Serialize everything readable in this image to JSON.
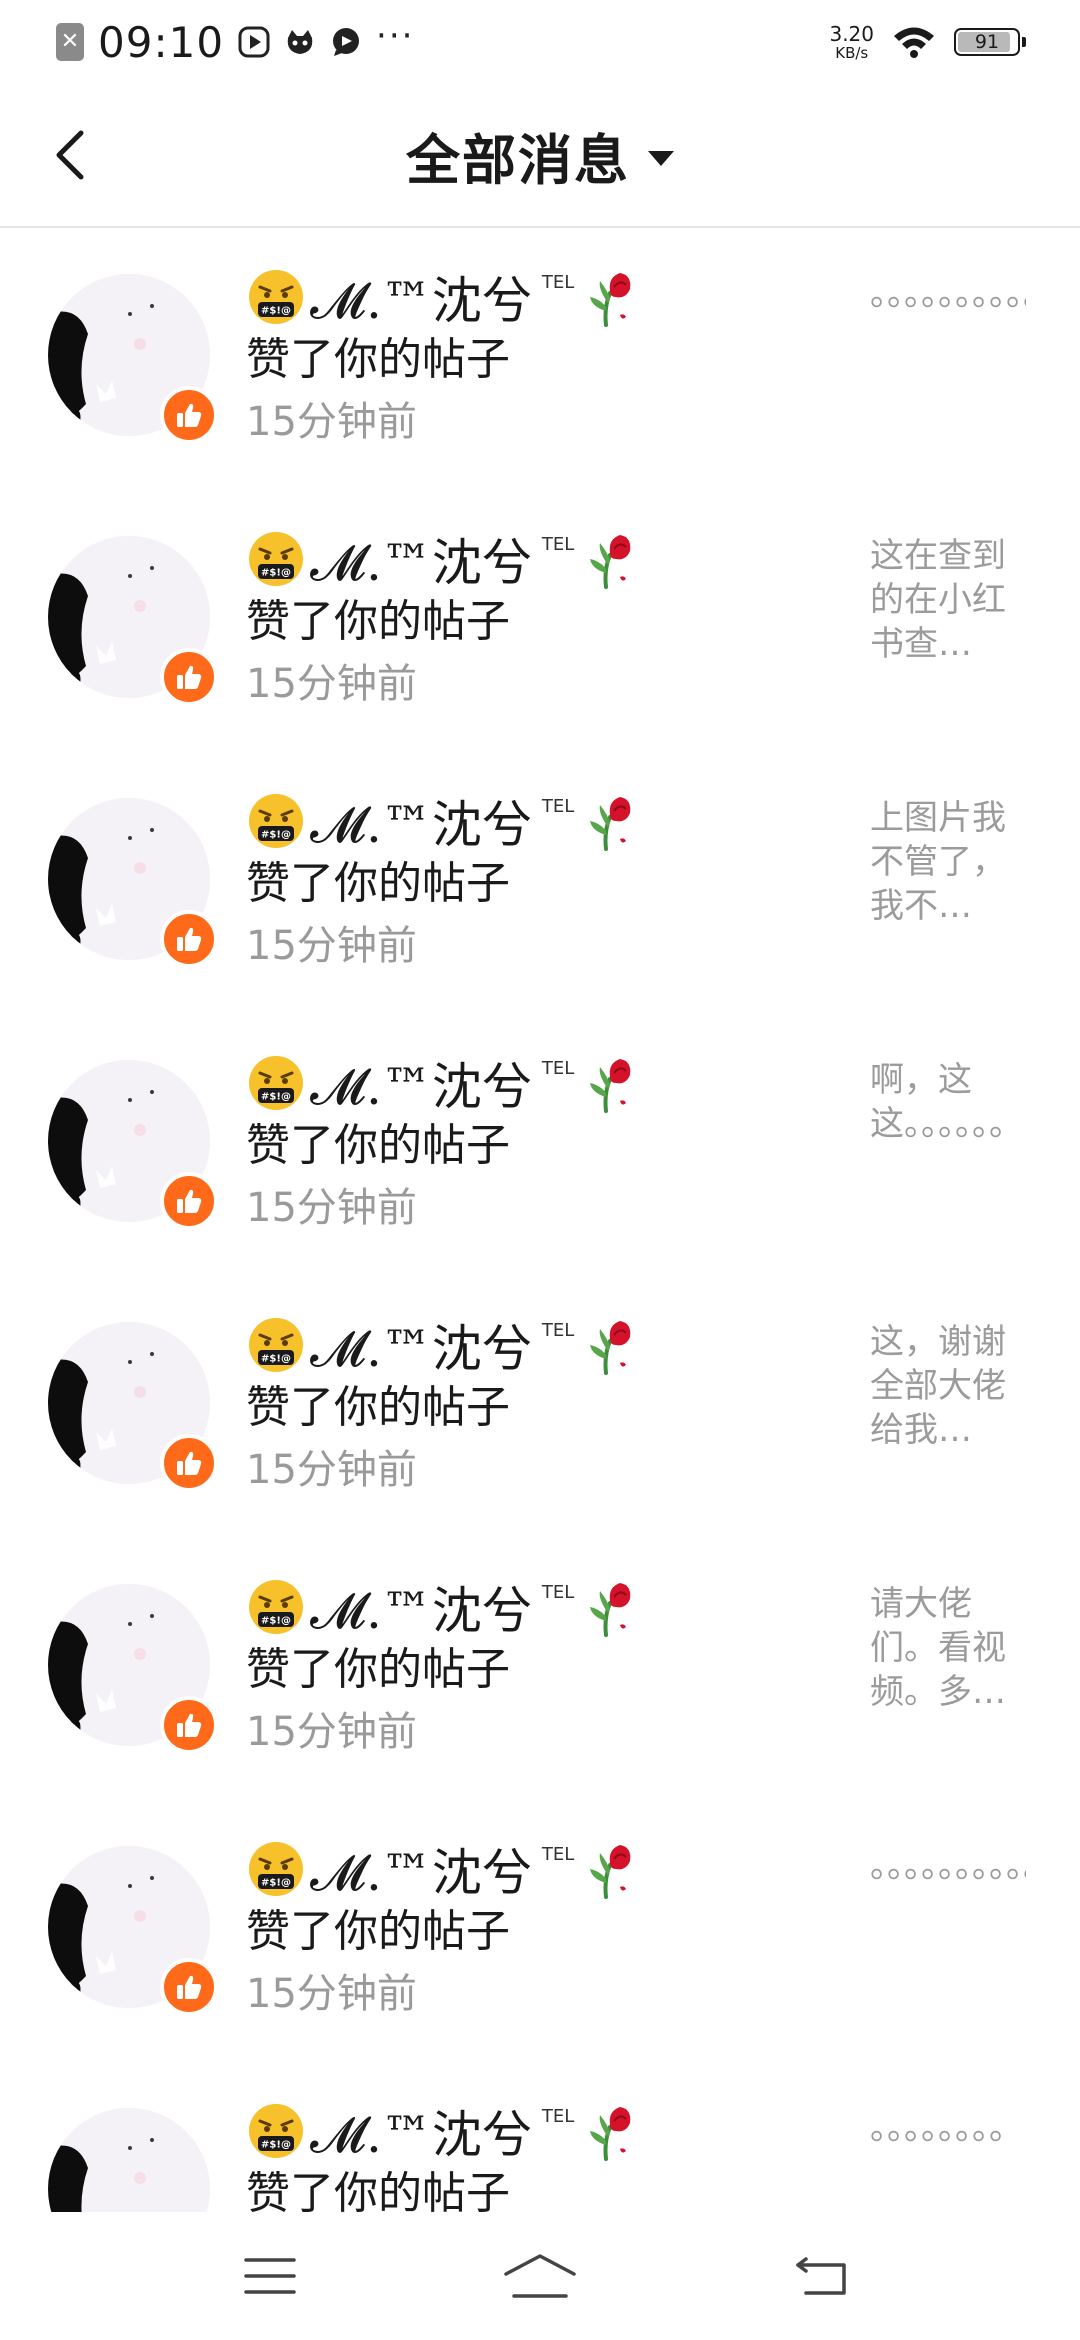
{
  "status_bar": {
    "time": "09:10",
    "sim_icon": "sim-error-icon",
    "app_icons": [
      "video-play-icon",
      "bilibili-cat-icon",
      "chat-bubble-icon"
    ],
    "more": "···",
    "speed_value": "3.20",
    "speed_unit": "KB/s",
    "wifi_icon": "wifi-icon",
    "battery": "91",
    "battery_level": 0.91
  },
  "header": {
    "back_icon": "chevron-left-icon",
    "title": "全部消息",
    "dropdown_icon": "caret-down-icon"
  },
  "notifications": [
    {
      "name": "𝓜.™沈兮",
      "tel": "TEL",
      "action": "赞了你的帖子",
      "time": "15分钟前",
      "preview": "。。。。。。。。。。…"
    },
    {
      "name": "𝓜.™沈兮",
      "tel": "TEL",
      "action": "赞了你的帖子",
      "time": "15分钟前",
      "preview": "这在查到的在小红书查…"
    },
    {
      "name": "𝓜.™沈兮",
      "tel": "TEL",
      "action": "赞了你的帖子",
      "time": "15分钟前",
      "preview": "上图片我不管了，我不…"
    },
    {
      "name": "𝓜.™沈兮",
      "tel": "TEL",
      "action": "赞了你的帖子",
      "time": "15分钟前",
      "preview": "啊，这这。。。。。。…"
    },
    {
      "name": "𝓜.™沈兮",
      "tel": "TEL",
      "action": "赞了你的帖子",
      "time": "15分钟前",
      "preview": "这，谢谢全部大佬给我…"
    },
    {
      "name": "𝓜.™沈兮",
      "tel": "TEL",
      "action": "赞了你的帖子",
      "time": "15分钟前",
      "preview": "请大佬们。看视频。多…"
    },
    {
      "name": "𝓜.™沈兮",
      "tel": "TEL",
      "action": "赞了你的帖子",
      "time": "15分钟前",
      "preview": "。。。。。。。。。。…"
    },
    {
      "name": "𝓜.™沈兮",
      "tel": "TEL",
      "action": "赞了你的帖子",
      "time": "15分钟前",
      "preview": "。。。。。。。。"
    }
  ],
  "colors": {
    "accent": "#ff6a1a",
    "text_primary": "#1a1a1a",
    "text_secondary": "#9a9a9a",
    "divider": "#e6e6e6"
  },
  "nav_bar": {
    "menu_icon": "menu-icon",
    "home_icon": "home-icon",
    "back_icon": "back-return-icon"
  }
}
